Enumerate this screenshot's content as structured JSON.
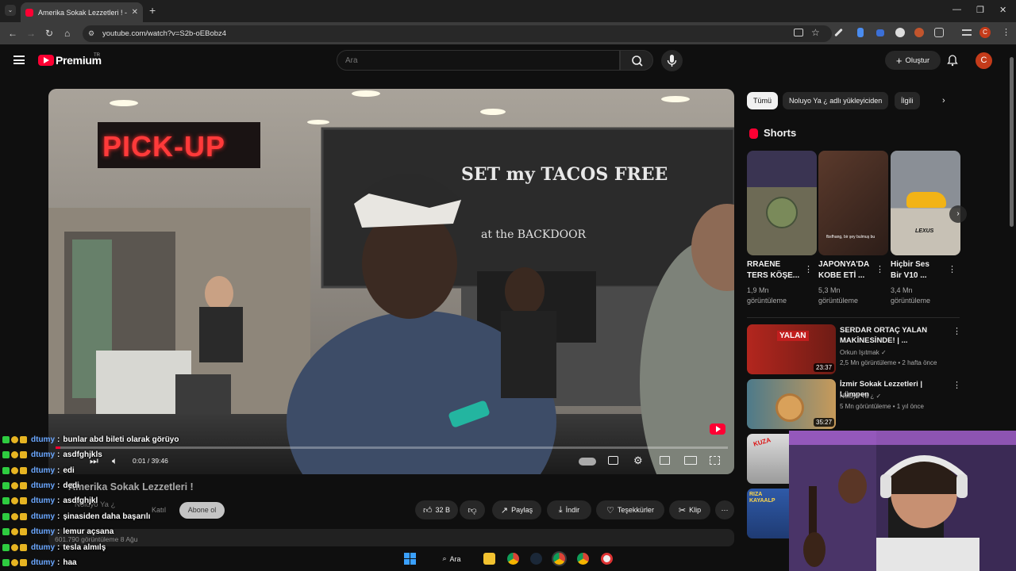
{
  "browser": {
    "tab_title": "Amerika Sokak Lezzetleri ! - Yo",
    "url": "youtube.com/watch?v=S2b-oEBobz4",
    "profile_initial": "C"
  },
  "header": {
    "brand": "Premium",
    "region": "TR",
    "search_placeholder": "Ara",
    "create_label": "Oluştur",
    "avatar_initial": "C"
  },
  "video": {
    "time": "0:01 / 39:46",
    "progress_fraction": 0.0004,
    "title": "Amerika Sokak Lezzetleri !",
    "channel": "Noluyo Ya ¿",
    "join_label": "Katıl",
    "subscribe_label": "Abone ol",
    "views_date": "601.790 görüntüleme  8 Ağu",
    "scene_signs": {
      "pickup": "PICK-UP",
      "chalk": "SET my TACOS FREE",
      "backdoor": "at the BACKDOOR"
    },
    "actions": {
      "likes": "32 B",
      "share": "Paylaş",
      "download": "İndir",
      "thanks": "Teşekkürler",
      "clip": "Klip"
    }
  },
  "sidebar": {
    "chips": [
      "Tümü",
      "Noluyo Ya ¿ adlı yükleyiciden",
      "İlgili"
    ],
    "shorts_title": "Shorts",
    "shorts": [
      {
        "title_line1": "RRAENE",
        "title_line2": "TERS KÖŞE...",
        "views_line1": "1,9 Mn",
        "views_line2": "görüntüleme"
      },
      {
        "title_line1": "JAPONYA'DA",
        "title_line2": "KOBE ETİ ...",
        "views_line1": "5,3 Mn",
        "views_line2": "görüntüleme"
      },
      {
        "title_line1": "Hiçbir Ses",
        "title_line2": "Bir V10 ...",
        "views_line1": "3,4 Mn",
        "views_line2": "görüntüleme"
      }
    ],
    "short_overlay_texts": {
      "s2": "fbsfhang, bir şey bulmuş bu",
      "s3": "LEXUS"
    },
    "recommended": [
      {
        "title_line1": "SERDAR ORTAÇ YALAN",
        "title_line2": "MAKİNESİNDE! | ...",
        "channel": "Orkun Işıtmak",
        "meta": "2,5 Mn görüntüleme • 2 hafta önce",
        "duration": "23:37",
        "thumb_text": "YALAN"
      },
      {
        "title_line1": "İzmir Sokak Lezzetleri | Lümpen",
        "title_line2": "",
        "channel": "Noluyo Ya ¿",
        "meta": "5 Mn görüntüleme • 1 yıl önce",
        "duration": "35:27",
        "thumb_text": ""
      },
      {
        "title_line1": "",
        "title_line2": "",
        "channel": "",
        "meta": "",
        "duration": "",
        "thumb_text": "KUZA"
      },
      {
        "title_line1": "",
        "title_line2": "",
        "channel": "",
        "meta": "",
        "duration": "",
        "thumb_text": "RIZA KAYAALP"
      }
    ]
  },
  "chat": [
    {
      "user": "dtumy",
      "msg": "bunlar abd bileti olarak görüyo"
    },
    {
      "user": "dtumy",
      "msg": "asdfghjkls"
    },
    {
      "user": "dtumy",
      "msg": "edi"
    },
    {
      "user": "dtumy",
      "msg": "dedi"
    },
    {
      "user": "dtumy",
      "msg": "asdfghjkl"
    },
    {
      "user": "dtumy",
      "msg": "şinasiden daha başarılı"
    },
    {
      "user": "dtumy",
      "msg": "lemur açsana"
    },
    {
      "user": "dtumy",
      "msg": "tesla almılş"
    },
    {
      "user": "dtumy",
      "msg": "haa"
    }
  ],
  "taskbar": {
    "search_label": "Ara"
  },
  "colors": {
    "accent_red": "#ff0033",
    "chat_user": "#6aa7ff",
    "badge_green": "#2ecc40",
    "badge_gold": "#e6b422",
    "background": "#0f0f0f"
  }
}
